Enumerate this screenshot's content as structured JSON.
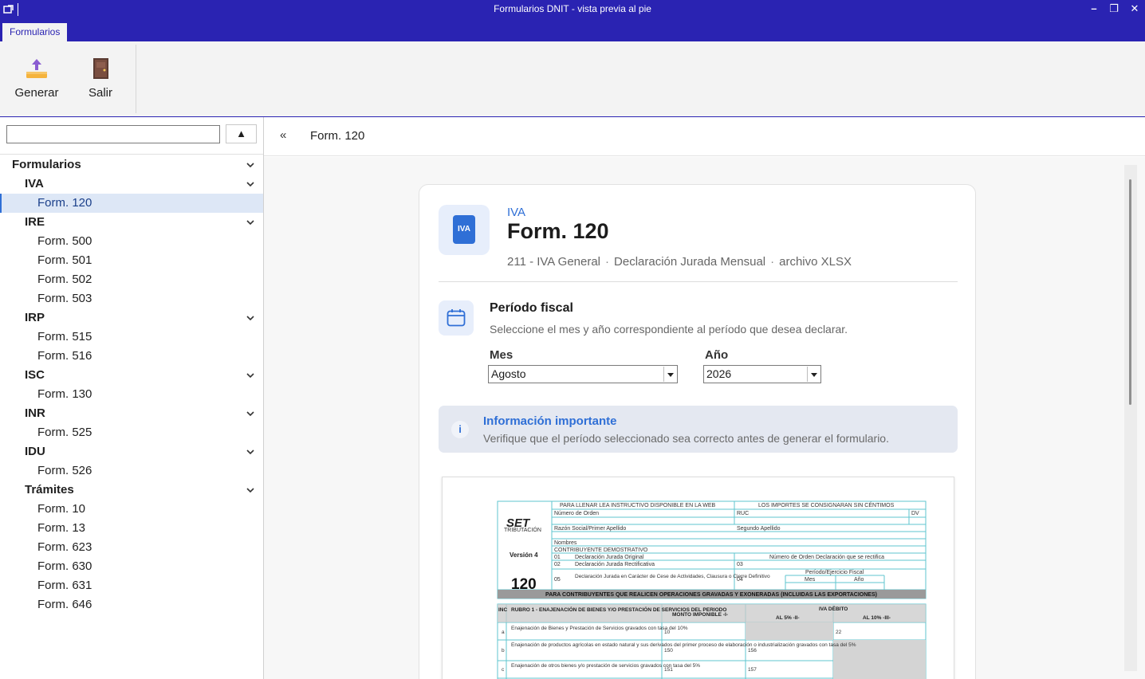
{
  "window": {
    "title": "Formularios DNIT - vista previa al pie",
    "minimize_label": "–",
    "maximize_label": "❐",
    "close_label": "✕"
  },
  "ribbon": {
    "tab_label": "Formularios",
    "buttons": [
      {
        "label": "Generar",
        "icon": "upload-icon"
      },
      {
        "label": "Salir",
        "icon": "door-icon"
      }
    ]
  },
  "sidebar": {
    "search_value": "",
    "collapse_label": "▲",
    "tree": {
      "root": "Formularios",
      "groups": [
        {
          "label": "IVA",
          "items": [
            "Form. 120"
          ]
        },
        {
          "label": "IRE",
          "items": [
            "Form. 500",
            "Form. 501",
            "Form. 502",
            "Form. 503"
          ]
        },
        {
          "label": "IRP",
          "items": [
            "Form. 515",
            "Form. 516"
          ]
        },
        {
          "label": "ISC",
          "items": [
            "Form. 130"
          ]
        },
        {
          "label": "INR",
          "items": [
            "Form. 525"
          ]
        },
        {
          "label": "IDU",
          "items": [
            "Form. 526"
          ]
        },
        {
          "label": "Trámites",
          "items": [
            "Form. 10",
            "Form. 13",
            "Form. 623",
            "Form. 630",
            "Form. 631",
            "Form. 646"
          ]
        }
      ],
      "selected": "Form. 120"
    }
  },
  "breadcrumb": {
    "back_label": "«",
    "current": "Form. 120"
  },
  "card": {
    "badge_text": "IVA",
    "category": "IVA",
    "title": "Form. 120",
    "meta": [
      "211 - IVA General",
      "Declaración Jurada Mensual",
      "archivo XLSX"
    ],
    "period": {
      "title": "Período fiscal",
      "description": "Seleccione el mes y año correspondiente al período que desea declarar.",
      "month_label": "Mes",
      "month_value": "Agosto",
      "year_label": "Año",
      "year_value": "2026"
    },
    "info": {
      "icon_text": "i",
      "title": "Información importante",
      "text": "Verifique que el período seleccionado sea correcto antes de generar el formulario."
    },
    "preview": {
      "header_left": "PARA LLENAR LEA INSTRUCTIVO DISPONIBLE EN LA WEB",
      "header_right": "LOS IMPORTES SE CONSIGNARAN SIN CÉNTIMOS",
      "logo_text": "SET",
      "logo_sub": "TRIBUTACIÓN",
      "version": "Versión 4",
      "form_number": "120",
      "numero_orden": "Número de Orden",
      "ruc": "RUC",
      "dv": "DV",
      "razon_social": "Razón Social/Primer Apellido",
      "segundo_apellido": "Segundo Apellido",
      "nombres": "Nombres",
      "contribuyente": "CONTRIBUYENTE DEMOSTRATIVO",
      "ddjj_original": "Declaración Jurada Original",
      "ddjj_rectificativa": "Declaración Jurada Rectificativa",
      "ddjj_cese": "Declaración Jurada en Carácter de Cese de Actividades, Clausura o Cierre Definitivo",
      "orden_rectifica": "Número de Orden Declaración que se rectifica",
      "periodo": "Período/Ejercicio Fiscal",
      "mes": "Mes",
      "anio": "Año",
      "code_01": "01",
      "code_02": "02",
      "code_03": "03",
      "code_04": "04",
      "code_05": "05",
      "banner": "PARA CONTRIBUYENTES QUE REALICEN OPERACIONES GRAVADAS Y EXONERADAS (INCLUIDAS LAS EXPORTACIONES)",
      "inc": "INC",
      "rubro": "RUBRO 1 - ENAJENACIÓN DE BIENES Y/O PRESTACIÓN DE SERVICIOS DEL PERIODO",
      "monto": "MONTO IMPONIBLE -I-",
      "iva_debito": "IVA DÉBITO",
      "al5": "AL 5% -II-",
      "al10": "AL 10% -III-",
      "rows": [
        {
          "letter": "a",
          "text": "Enajenación de Bienes y Prestación de Servicios gravados con tasa del 10%",
          "c1": "10",
          "c2": "",
          "c3": "22"
        },
        {
          "letter": "b",
          "text": "Enajenación de productos agrícolas en estado natural y sus derivados del primer proceso de elaboración o industrialización gravados con tasa del 5%",
          "c1": "150",
          "c2": "156",
          "c3": ""
        },
        {
          "letter": "c",
          "text": "Enajenación de otros bienes y/o prestación de servicios gravados con tasa del 5%",
          "c1": "151",
          "c2": "157",
          "c3": ""
        }
      ]
    }
  },
  "colors": {
    "titlebar": "#2a23b2",
    "accent": "#2f6fd6",
    "preview_teal": "#5fc6cf",
    "preview_gray": "#9a9a9a"
  }
}
